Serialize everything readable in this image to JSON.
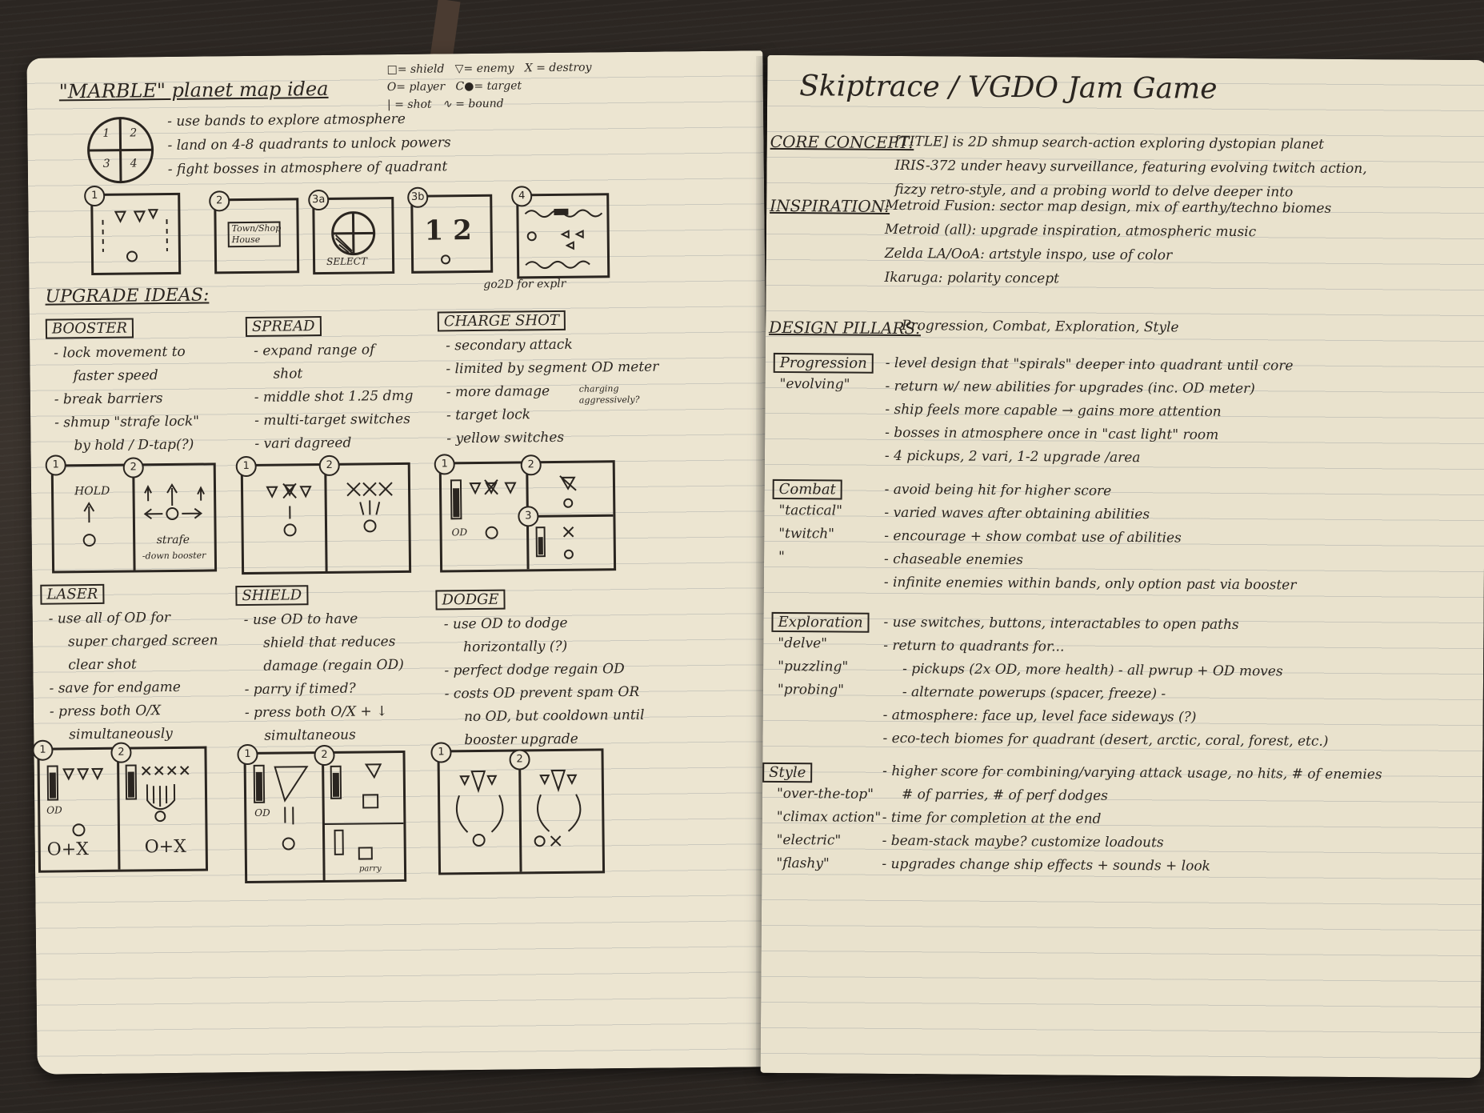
{
  "left_page": {
    "title": "\"MARBLE\" planet map idea",
    "legend": [
      "□= shield",
      "▽= enemy",
      "X = destroy",
      "O= player",
      "C●= target",
      "| = shot",
      "∿ = bound"
    ],
    "planet_quadrants": [
      "1",
      "2",
      "3",
      "4"
    ],
    "planet_notes": [
      "- use bands to explore atmosphere",
      "- land on 4-8 quadrants to unlock powers",
      "- fight bosses in atmosphere of quadrant"
    ],
    "map_panel_numbers": [
      "1",
      "2",
      "3a",
      "3b",
      "4"
    ],
    "map_sketch_texts": {
      "town": "Town/Shop House",
      "select": "SELECT",
      "nums": "1  2",
      "goal_note": "go2D for explr"
    },
    "upgrade_heading": "UPGRADE IDEAS:",
    "upgrades": [
      {
        "name": "BOOSTER",
        "notes": [
          "- lock movement to",
          "faster speed",
          "- break barriers",
          "- shmup \"strafe lock\"",
          "by hold / D-tap(?)"
        ]
      },
      {
        "name": "SPREAD",
        "notes": [
          "- expand range of",
          "shot",
          "- middle shot 1.25 dmg",
          "- multi-target switches",
          "- vari dagreed"
        ]
      },
      {
        "name": "CHARGE SHOT",
        "notes": [
          "- secondary attack",
          "- limited by segment OD meter",
          "- more damage",
          "- target lock",
          "- yellow switches"
        ],
        "side_note": "charging aggressively?"
      },
      {
        "name": "LASER",
        "notes": [
          "- use all of OD for",
          "super charged screen",
          "clear shot",
          "- save for endgame",
          "- press both O/X",
          "simultaneously"
        ]
      },
      {
        "name": "SHIELD",
        "notes": [
          "- use OD to have",
          "shield that reduces",
          "damage (regain OD)",
          "- parry if timed?",
          "- press both O/X + ↓",
          "simultaneous"
        ]
      },
      {
        "name": "DODGE",
        "notes": [
          "- use OD to dodge",
          "horizontally (?)",
          "- perfect dodge regain OD",
          "- costs OD prevent spam OR",
          "no OD, but cooldown until",
          "booster upgrade"
        ]
      }
    ],
    "sketch_texts": {
      "hold": "HOLD",
      "strafe": "strafe",
      "down_boost": "-down booster",
      "od": "OD",
      "combo_a": "O+X",
      "combo_b": "O+X",
      "parry": "parry"
    }
  },
  "right_page": {
    "title": "Skiptrace / VGDO Jam Game",
    "core_concept_label": "CORE CONCEPT:",
    "core_concept": [
      "[TITLE] is 2D shmup search-action exploring dystopian planet",
      "IRIS-372 under heavy surveillance, featuring evolving twitch action,",
      "fizzy retro-style, and a probing world to delve deeper into"
    ],
    "inspiration_label": "INSPIRATION:",
    "inspiration": [
      "Metroid Fusion: sector map design, mix of earthy/techno biomes",
      "Metroid (all): upgrade inspiration, atmospheric music",
      "Zelda LA/OoA: artstyle inspo, use of color",
      "Ikaruga: polarity concept"
    ],
    "design_pillars_label": "DESIGN PILLARS:",
    "design_pillars": "Progression, Combat, Exploration, Style",
    "pillars": [
      {
        "name": "Progression",
        "tags": [
          "\"evolving\""
        ],
        "notes": [
          "- level design that \"spirals\" deeper into quadrant until core",
          "- return w/ new abilities for upgrades (inc. OD meter)",
          "- ship feels more capable → gains more attention",
          "- bosses in atmosphere once in \"cast light\" room",
          "- 4 pickups, 2 vari, 1-2 upgrade /area"
        ]
      },
      {
        "name": "Combat",
        "tags": [
          "\"tactical\"",
          "\"twitch\"",
          "\""
        ],
        "notes": [
          "- avoid being hit for higher score",
          "- varied waves after obtaining abilities",
          "- encourage + show combat use of abilities",
          "- chaseable enemies",
          "- infinite enemies within bands, only option past via booster"
        ]
      },
      {
        "name": "Exploration",
        "tags": [
          "\"delve\"",
          "\"puzzling\"",
          "\"probing\""
        ],
        "notes": [
          "- use switches, buttons, interactables to open paths",
          "- return to quadrants for...",
          "- pickups (2x OD, more health) - all pwrup + OD moves",
          "- alternate powerups (spacer, freeze) -",
          "- atmosphere: face up, level face sideways (?)",
          "- eco-tech biomes for quadrant (desert, arctic, coral, forest, etc.)"
        ]
      },
      {
        "name": "Style",
        "tags": [
          "\"over-the-top\"",
          "\"climax action\"",
          "\"electric\"",
          "\"flashy\""
        ],
        "notes": [
          "- higher score for combining/varying attack usage, no hits, # of enemies",
          "# of parries, # of perf dodges",
          "- time for completion at the end",
          "- beam-stack maybe? customize loadouts",
          "- upgrades change ship effects + sounds + look"
        ]
      }
    ]
  }
}
